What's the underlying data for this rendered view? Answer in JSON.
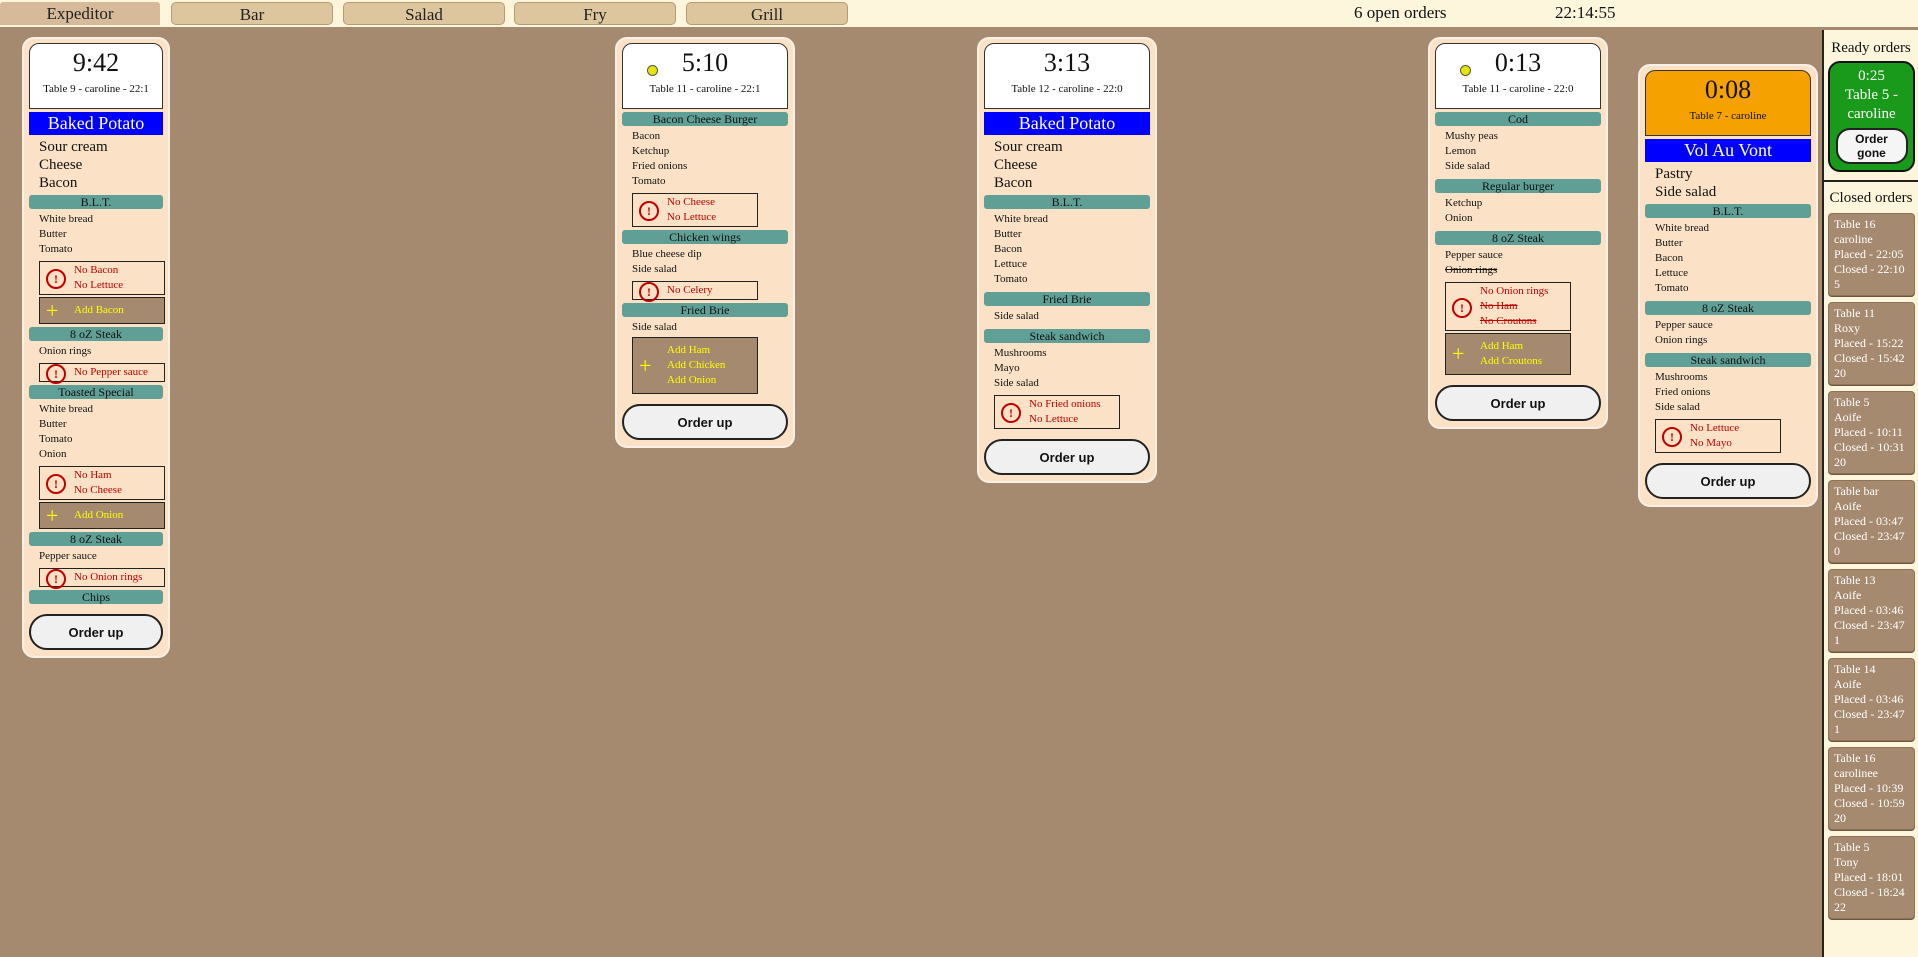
{
  "tabs": {
    "expeditor": "Expeditor",
    "bar": "Bar",
    "salad": "Salad",
    "fry": "Fry",
    "grill": "Grill"
  },
  "status": {
    "open_orders": "6 open orders",
    "clock": "22:14:55"
  },
  "order_up_label": "Order up",
  "orders": {
    "o1": {
      "timer": "9:42",
      "sub": "Table 9 - caroline - 22:1",
      "main": "Baked Potato",
      "main_mods": [
        "Sour cream",
        "Cheese",
        "Bacon"
      ],
      "blt": {
        "name": "B.L.T.",
        "mods": [
          "White bread",
          "Butter",
          "Tomato"
        ],
        "warn": [
          "No Bacon",
          "No Lettuce"
        ],
        "add": [
          "Add Bacon"
        ]
      },
      "steak1": {
        "name": "8 oZ Steak",
        "mods": [
          "Onion rings"
        ],
        "warn": [
          "No Pepper sauce"
        ]
      },
      "toasted": {
        "name": "Toasted Special",
        "mods": [
          "White bread",
          "Butter",
          "Tomato",
          "Onion"
        ],
        "warn": [
          "No Ham",
          "No Cheese"
        ],
        "add": [
          "Add Onion"
        ]
      },
      "steak2": {
        "name": "8 oZ Steak",
        "mods": [
          "Pepper sauce"
        ],
        "warn": [
          "No Onion rings"
        ]
      },
      "chips": {
        "name": "Chips"
      }
    },
    "o2": {
      "timer": "5:10",
      "sub": "Table 11 - caroline - 22:1",
      "bcb": {
        "name": "Bacon Cheese Burger",
        "mods": [
          "Bacon",
          "Ketchup",
          "Fried onions",
          "Tomato"
        ],
        "warn": [
          "No Cheese",
          "No Lettuce"
        ]
      },
      "wings": {
        "name": "Chicken wings",
        "mods": [
          "Blue cheese dip",
          "Side salad"
        ],
        "warn": [
          "No Celery"
        ]
      },
      "brie": {
        "name": "Fried Brie",
        "mods": [
          "Side salad"
        ],
        "add": [
          "Add Ham",
          "Add Chicken",
          "Add Onion"
        ]
      }
    },
    "o3": {
      "timer": "3:13",
      "sub": "Table 12 - caroline - 22:0",
      "main": "Baked Potato",
      "main_mods": [
        "Sour cream",
        "Cheese",
        "Bacon"
      ],
      "blt": {
        "name": "B.L.T.",
        "mods": [
          "White bread",
          "Butter",
          "Bacon",
          "Lettuce",
          "Tomato"
        ]
      },
      "brie": {
        "name": "Fried Brie",
        "mods": [
          "Side salad"
        ]
      },
      "steaksand": {
        "name": "Steak sandwich",
        "mods": [
          "Mushrooms",
          "Mayo",
          "Side salad"
        ],
        "warn": [
          "No Fried onions",
          "No Lettuce"
        ]
      }
    },
    "o4": {
      "timer": "0:13",
      "sub": "Table 11 - caroline - 22:0",
      "cod": {
        "name": "Cod",
        "mods": [
          "Mushy peas",
          "Lemon",
          "Side salad"
        ]
      },
      "burger": {
        "name": "Regular burger",
        "mods": [
          "Ketchup",
          "Onion"
        ]
      },
      "steak": {
        "name": "8 oZ Steak",
        "mods": [
          "Pepper sauce",
          "Onion rings"
        ],
        "warn": [
          "No Onion rings",
          "No Ham",
          "No Croutons"
        ],
        "add": [
          "Add Ham",
          "Add Croutons"
        ]
      }
    },
    "o5": {
      "timer": "0:08",
      "sub": "Table 7 - caroline",
      "main": "Vol Au Vont",
      "main_mods": [
        "Pastry",
        "Side salad"
      ],
      "blt": {
        "name": "B.L.T.",
        "mods": [
          "White bread",
          "Butter",
          "Bacon",
          "Lettuce",
          "Tomato"
        ]
      },
      "steak": {
        "name": "8 oZ Steak",
        "mods": [
          "Pepper sauce",
          "Onion rings"
        ]
      },
      "steaksand": {
        "name": "Steak sandwich",
        "mods": [
          "Mushrooms",
          "Fried onions",
          "Side salad"
        ],
        "warn": [
          "No Lettuce",
          "No Mayo"
        ]
      }
    }
  },
  "sidebar": {
    "ready_title": "Ready orders",
    "ready": {
      "time": "0:25",
      "table": "Table 5 -",
      "name": "caroline",
      "button": "Order gone"
    },
    "closed_title": "Closed orders",
    "closed": [
      {
        "table": "Table 16",
        "name": "caroline",
        "placed": "Placed - 22:05",
        "closed": "Closed - 22:10",
        "n": "5"
      },
      {
        "table": "Table 11",
        "name": "Roxy",
        "placed": "Placed - 15:22",
        "closed": "Closed - 15:42",
        "n": "20"
      },
      {
        "table": "Table 5",
        "name": "Aoife",
        "placed": "Placed - 10:11",
        "closed": "Closed - 10:31",
        "n": "20"
      },
      {
        "table": "Table bar",
        "name": "Aoife",
        "placed": "Placed - 03:47",
        "closed": "Closed - 23:47",
        "n": "0"
      },
      {
        "table": "Table 13",
        "name": "Aoife",
        "placed": "Placed - 03:46",
        "closed": "Closed - 23:47",
        "n": "1"
      },
      {
        "table": "Table 14",
        "name": "Aoife",
        "placed": "Placed - 03:46",
        "closed": "Closed - 23:47",
        "n": "1"
      },
      {
        "table": "Table 16",
        "name": "carolinee",
        "placed": "Placed - 10:39",
        "closed": "Closed - 10:59",
        "n": "20"
      },
      {
        "table": "Table 5",
        "name": "Tony",
        "placed": "Placed - 18:01",
        "closed": "Closed - 18:24",
        "n": "22"
      }
    ]
  },
  "colors": {
    "background": "#a68a70",
    "card": "#fbe2c7",
    "section": "#5f9f96",
    "main_item": "#0000ff",
    "warning": "#c00000",
    "ready": "#1a9a1a",
    "fresh": "#f5a200"
  }
}
